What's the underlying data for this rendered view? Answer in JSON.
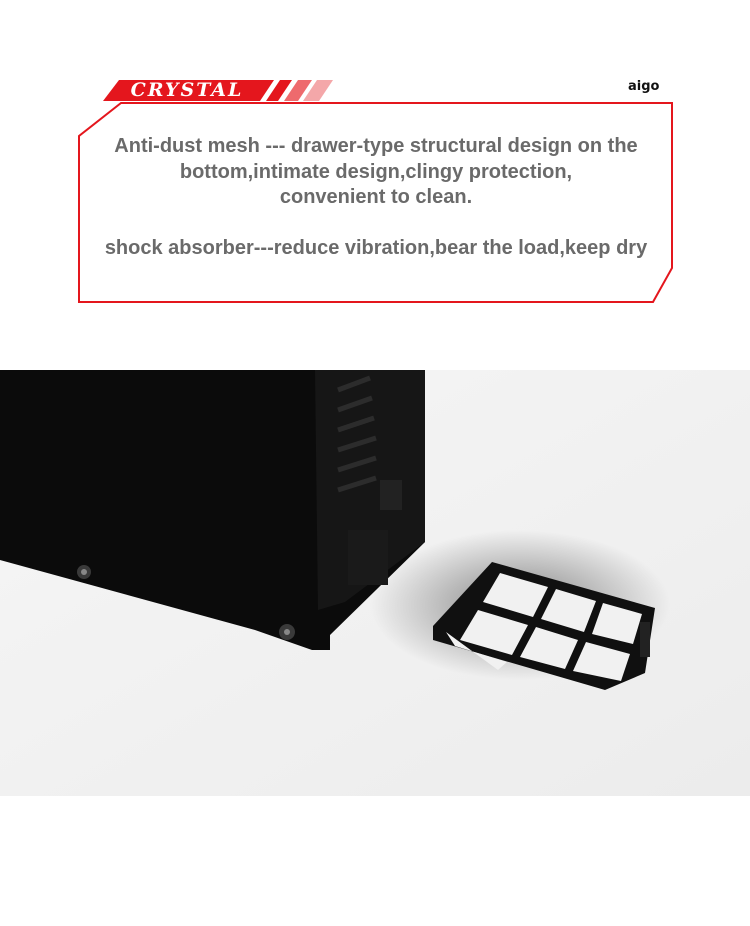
{
  "header": {
    "title": "CRYSTAL",
    "brand": "aigo",
    "accent_color": "#e4161d"
  },
  "description": {
    "line1": "Anti-dust mesh --- drawer-type structural design on the",
    "line2": "bottom,intimate design,clingy protection,",
    "line3": "convenient to clean.",
    "line4": "shock absorber---reduce vibration,bear the load,keep dry"
  },
  "photo": {
    "subject": "pc-case-with-removable-dust-filter",
    "case_color": "#0b0b0b",
    "background_color": "#f2f2f2"
  }
}
